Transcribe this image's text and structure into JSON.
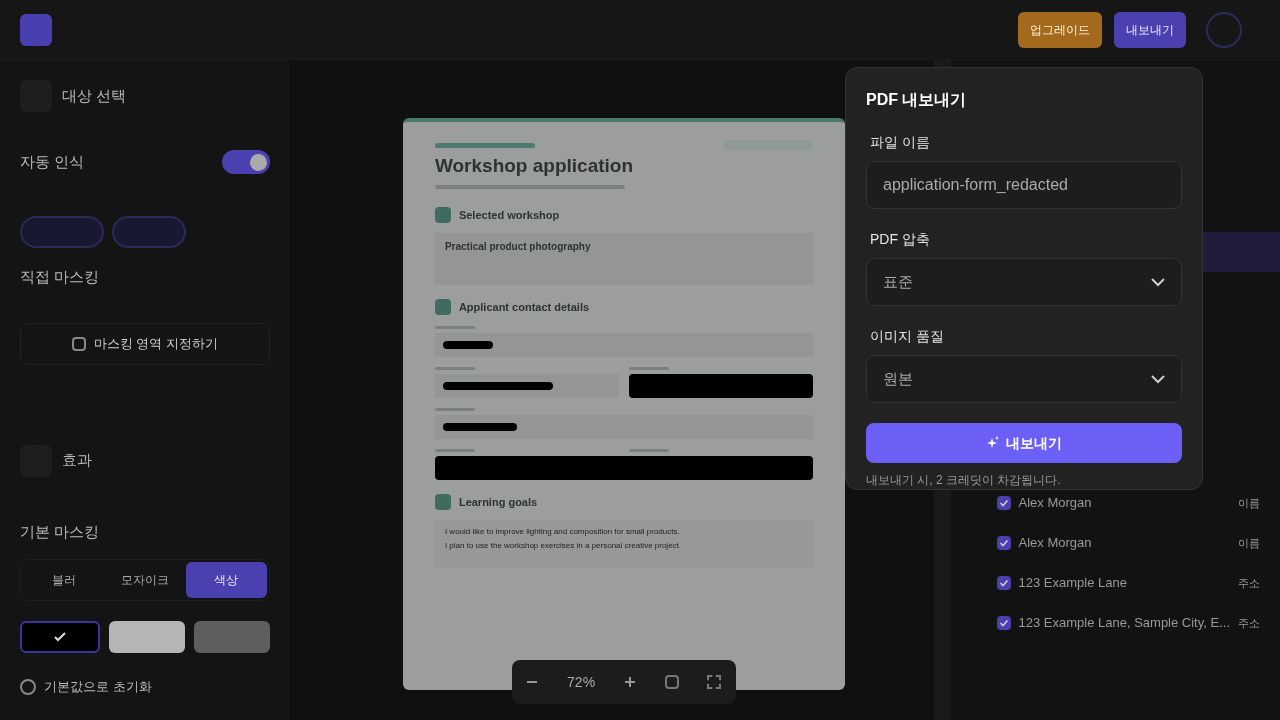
{
  "topbar": {
    "upgrade_button": "업그레이드",
    "export_button": "내보내기"
  },
  "sidebar": {
    "target_title": "대상 선택",
    "auto_detect": {
      "label": "자동 인식",
      "on": true
    },
    "manual_title": "직접 마스킹",
    "manual_button": "마스킹 영역 지정하기",
    "effects_title": "효과",
    "basic_title": "기본 마스킹",
    "modes": [
      {
        "label": "블러",
        "selected": false
      },
      {
        "label": "모자이크",
        "selected": false
      },
      {
        "label": "색상",
        "selected": true
      }
    ],
    "swatches": [
      {
        "color": "#000000",
        "selected": true
      },
      {
        "color": "#b5b5b5",
        "selected": false
      },
      {
        "color": "#5e5e5e",
        "selected": false
      }
    ],
    "reset_button": "기본값으로 초기화"
  },
  "document": {
    "title": "Workshop application",
    "sections": [
      {
        "title": "Selected workshop"
      },
      {
        "title": "Applicant contact details"
      },
      {
        "title": "Learning goals"
      }
    ],
    "workshop": "Practical product photography",
    "goals": [
      "I would like to improve lighting and composition for small products.",
      "I plan to use the workshop exercises in a personal creative project."
    ]
  },
  "zoom": {
    "value": "72%"
  },
  "detections": [
    {
      "label": "Alex Morgan",
      "tag": "이름",
      "checked": true
    },
    {
      "label": "Alex Morgan",
      "tag": "이름",
      "checked": true
    },
    {
      "label": "123 Example Lane",
      "tag": "주소",
      "checked": true
    },
    {
      "label": "123 Example Lane, Sample City, E...",
      "tag": "주소",
      "checked": true
    }
  ],
  "dialog": {
    "title": "PDF 내보내기",
    "file_label": "파일 이름",
    "file_value": "application-form_redacted",
    "compression_label": "PDF 압축",
    "compression_value": "표준",
    "quality_label": "이미지 품질",
    "quality_value": "원본",
    "export_button": "내보내기",
    "note": "내보내기 시, 2 크레딧이 차감됩니다."
  }
}
